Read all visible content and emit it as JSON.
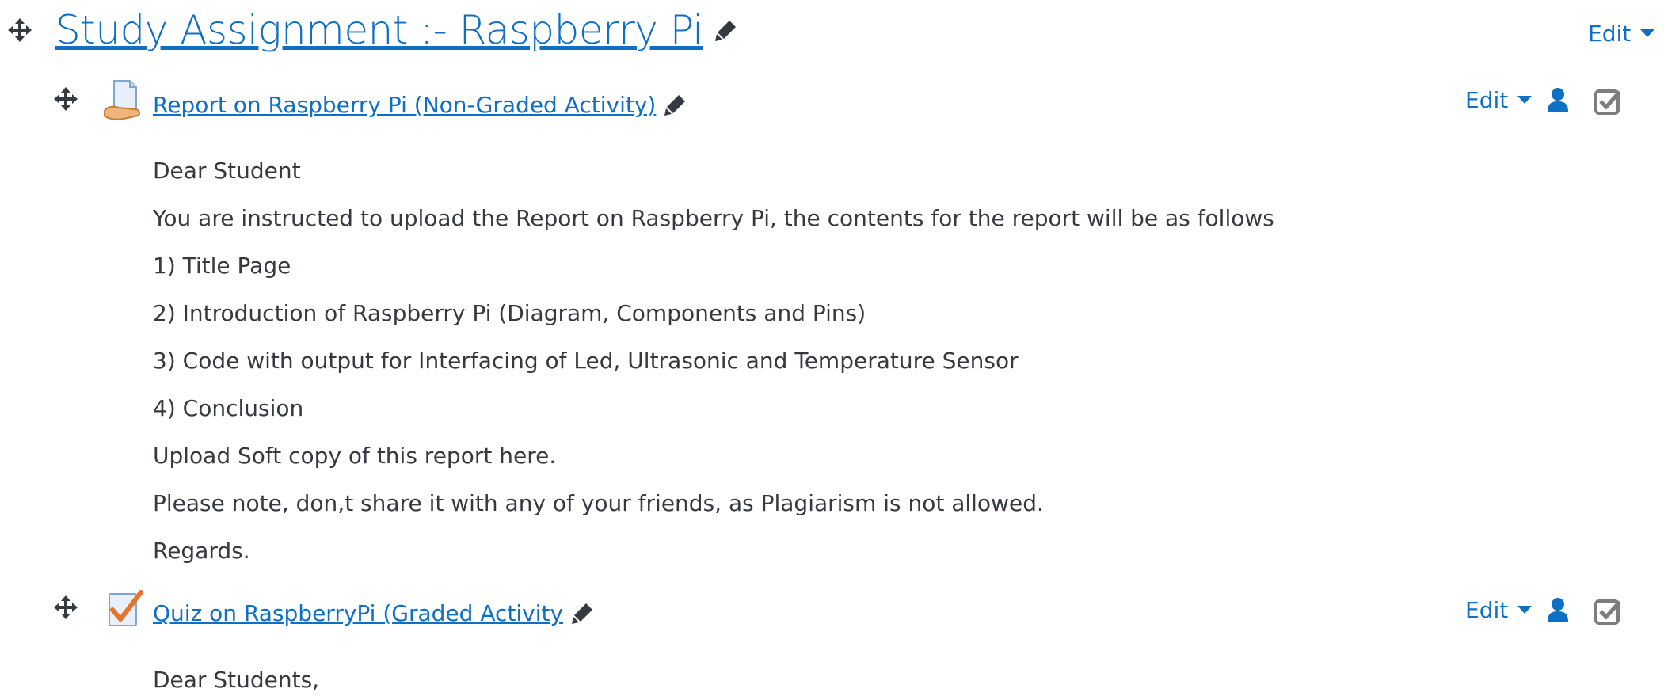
{
  "section": {
    "title": "Study Assignment :- Raspberry Pi",
    "edit_label": "Edit"
  },
  "activities": [
    {
      "title": "Report on Raspberry Pi (Non-Graded Activity)",
      "type_icon": "assignment-icon",
      "edit_label": "Edit",
      "description": [
        "Dear Student",
        "You are instructed to upload the Report on Raspberry Pi, the contents for the report will be as follows",
        "1) Title Page",
        "2) Introduction of Raspberry Pi (Diagram, Components and Pins)",
        "3) Code with output for Interfacing of Led, Ultrasonic and Temperature Sensor",
        "4) Conclusion",
        "Upload Soft copy of this report here.",
        "Please note, don,t share it with any of your friends, as Plagiarism is not allowed.",
        "Regards."
      ]
    },
    {
      "title": "Quiz on RaspberryPi (Graded Activity",
      "type_icon": "quiz-icon",
      "edit_label": "Edit",
      "description": [
        "Dear Students,"
      ]
    }
  ],
  "colors": {
    "link": "#0f6fc5",
    "text": "#343a40",
    "icon_dark": "#343a40",
    "icon_gray": "#7d7d7d"
  }
}
